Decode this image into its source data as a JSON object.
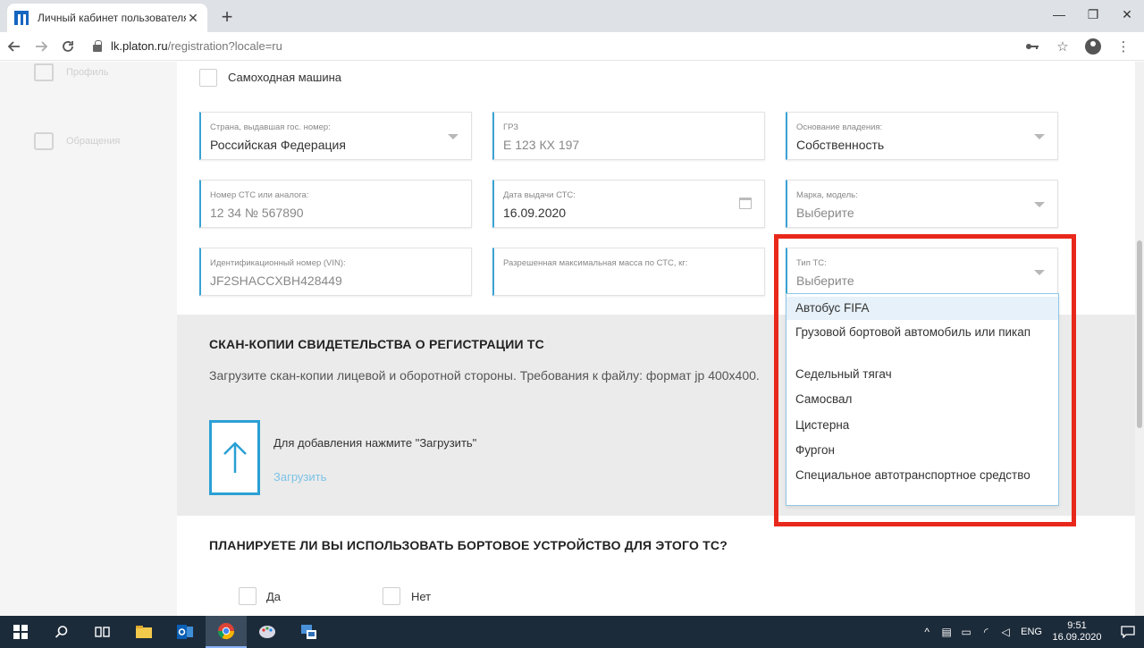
{
  "browser": {
    "tab_title": "Личный кабинет пользователя",
    "tab_close": "✕",
    "new_tab": "+",
    "url_host": "lk.platon.ru",
    "url_path": "/registration?locale=ru",
    "win_minimize": "—",
    "win_maximize": "❐",
    "win_close": "✕"
  },
  "sidebar": {
    "items": [
      {
        "label": "Профиль",
        "icon": "document-icon"
      },
      {
        "label": "Обращения",
        "icon": "message-icon"
      }
    ]
  },
  "form": {
    "self_propelled_label": "Самоходная машина",
    "fields": {
      "country": {
        "label": "Страна, выдавшая гос. номер:",
        "value": "Российская Федерация"
      },
      "plate": {
        "label": "ГРЗ",
        "value": "Е 123 КХ 197"
      },
      "ownership": {
        "label": "Основание владения:",
        "value": "Собственность"
      },
      "sts_number": {
        "label": "Номер СТС или аналога:",
        "value": "12 34 № 567890"
      },
      "sts_date": {
        "label": "Дата выдачи СТС:",
        "value": "16.09.2020"
      },
      "brand_model": {
        "label": "Марка, модель:",
        "value": "Выберите"
      },
      "vin": {
        "label": "Идентификационный номер (VIN):",
        "value": "JF2SHACCXBH428449"
      },
      "max_mass": {
        "label": "Разрешенная максимальная масса по СТС, кг:",
        "value": ""
      },
      "vehicle_type": {
        "label": "Тип ТС:",
        "value": "Выберите"
      }
    }
  },
  "vehicle_type_options": [
    "Автобус FIFA",
    "Грузовой бортовой автомобиль или пикап",
    "Седельный тягач",
    "Самосвал",
    "Цистерна",
    "Фургон",
    "Специальное автотранспортное средство"
  ],
  "scan_section": {
    "title": "СКАН-КОПИИ СВИДЕТЕЛЬСТВА О РЕГИСТРАЦИИ ТС",
    "description": "Загрузите скан-копии лицевой и оборотной стороны. Требования к файлу: формат jp 400x400.",
    "hint": "Для добавления нажмите \"Загрузить\"",
    "upload_link": "Загрузить"
  },
  "onboard_section": {
    "title": "ПЛАНИРУЕТЕ ЛИ ВЫ ИСПОЛЬЗОВАТЬ БОРТОВОЕ УСТРОЙСТВО ДЛЯ ЭТОГО ТС?",
    "yes": "Да",
    "no": "Нет"
  },
  "taskbar": {
    "language": "ENG",
    "time": "9:51",
    "date": "16.09.2020"
  },
  "colors": {
    "accent": "#39a3d3",
    "highlight": "#e8281b"
  }
}
